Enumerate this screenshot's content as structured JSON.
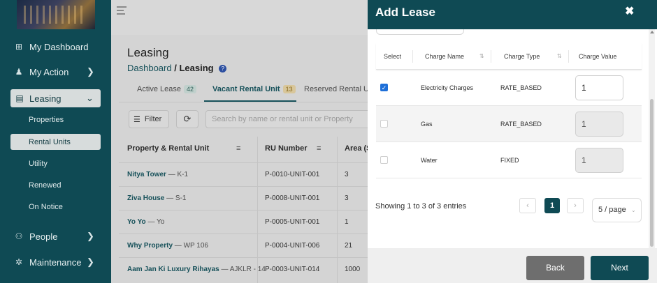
{
  "sidebar": {
    "items": [
      {
        "label": "My Dashboard",
        "icon": "dashboard-icon"
      },
      {
        "label": "My Action",
        "icon": "person-icon"
      },
      {
        "label": "Leasing",
        "icon": "clipboard-icon"
      },
      {
        "label": "People",
        "icon": "people-icon"
      },
      {
        "label": "Maintenance",
        "icon": "wrench-icon"
      }
    ],
    "leasing_sub": [
      "Properties",
      "Rental Units",
      "Utility",
      "Renewed",
      "On Notice"
    ]
  },
  "page": {
    "title": "Leasing",
    "breadcrumb_root": "Dashboard",
    "breadcrumb_sep": "/",
    "breadcrumb_current": "Leasing"
  },
  "tabs": [
    {
      "label": "Active Lease",
      "badge": "42"
    },
    {
      "label": "Vacant Rental Unit",
      "badge": "13"
    },
    {
      "label": "Reserved Rental Unit",
      "badge": ""
    }
  ],
  "toolbar": {
    "filter_label": "Filter",
    "search_placeholder": "Search by name or rental unit or Property"
  },
  "bg_table": {
    "headers": [
      "Property & Rental Unit",
      "RU Number",
      "Area (S"
    ],
    "rows": [
      {
        "property": "Nitya Tower",
        "unit": "— K-1",
        "ru": "P-0010-UNIT-001",
        "area": "3"
      },
      {
        "property": "Ziva House",
        "unit": "— S-1",
        "ru": "P-0008-UNIT-001",
        "area": "3"
      },
      {
        "property": "Yo Yo",
        "unit": "— Yo",
        "ru": "P-0005-UNIT-001",
        "area": "1"
      },
      {
        "property": "Why Property",
        "unit": "— WP 106",
        "ru": "P-0004-UNIT-006",
        "area": "21"
      },
      {
        "property": "Aam Jan Ki Luxury Rihayas",
        "unit": "— AJKLR - 14",
        "ru": "P-0003-UNIT-014",
        "area": "1000"
      }
    ]
  },
  "modal": {
    "title": "Add Lease",
    "close_glyph": "✖",
    "table_headers": {
      "select": "Select",
      "name": "Charge Name",
      "type": "Charge Type",
      "value": "Charge Value"
    },
    "rows": [
      {
        "name": "Electricity Charges",
        "type": "RATE_BASED",
        "value": "1",
        "checked": true
      },
      {
        "name": "Gas",
        "type": "RATE_BASED",
        "value": "1",
        "checked": false
      },
      {
        "name": "Water",
        "type": "FIXED",
        "value": "1",
        "checked": false
      }
    ],
    "showing": "Showing 1 to 3 of 3 entries",
    "page_current": "1",
    "page_size": "5 / page",
    "back_label": "Back",
    "next_label": "Next"
  },
  "colors": {
    "brand": "#0f4a54",
    "checkbox": "#1e6fd8",
    "back_button": "#6e6e6e"
  }
}
